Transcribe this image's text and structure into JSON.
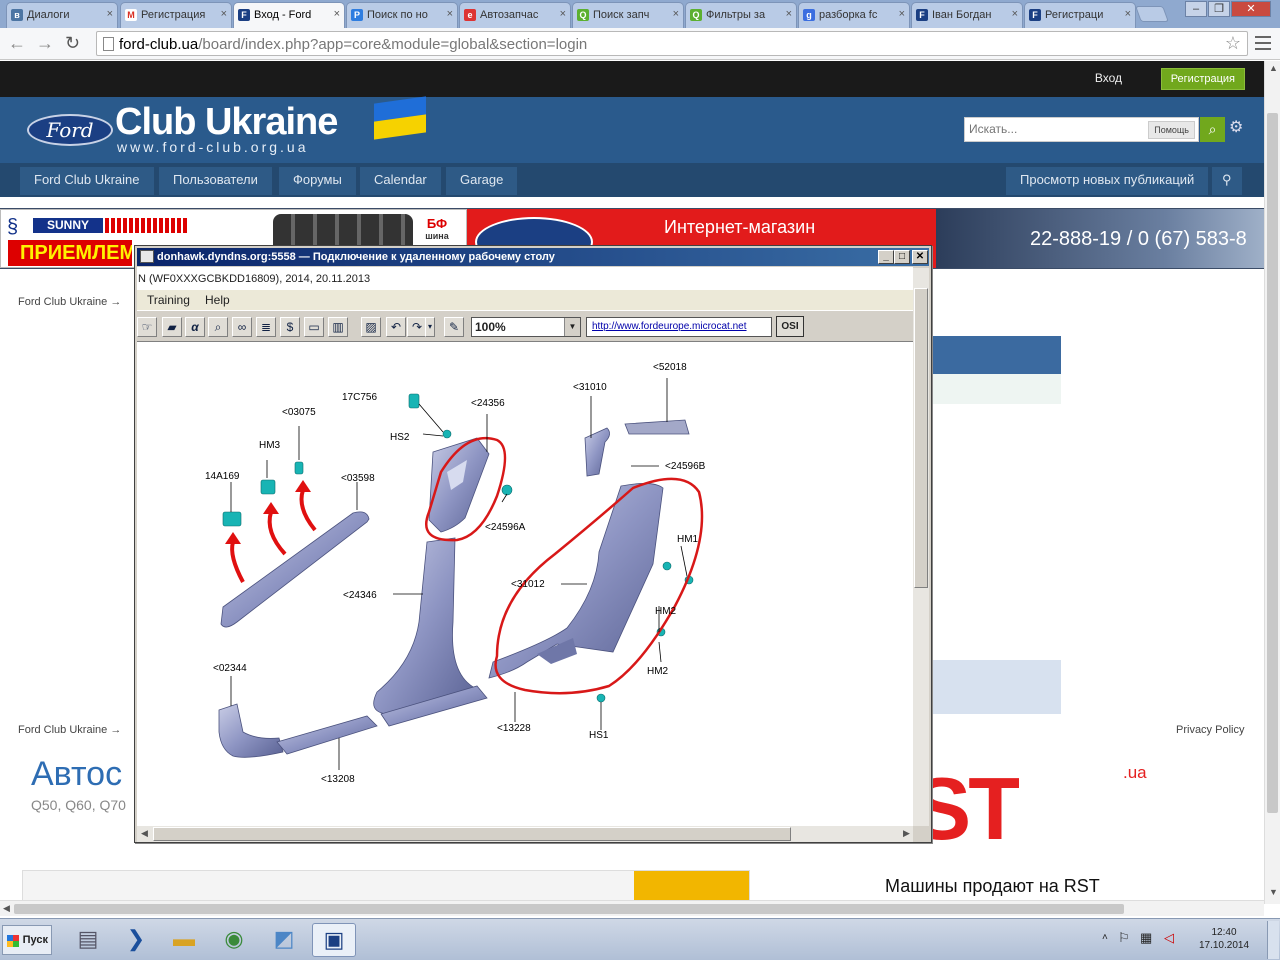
{
  "browser": {
    "tabs": [
      {
        "label": "Диалоги",
        "icon": "vk-icon",
        "color": "#4c75a3"
      },
      {
        "label": "Регистрация",
        "icon": "gmail-icon",
        "color": "#d93025"
      },
      {
        "label": "Вход - Ford",
        "icon": "ford-icon",
        "color": "#1b3f83",
        "active": true
      },
      {
        "label": "Поиск по но",
        "icon": "parts-icon",
        "color": "#2e7de0"
      },
      {
        "label": "Автозапчас",
        "icon": "exist-icon",
        "color": "#d33"
      },
      {
        "label": "Поиск запч",
        "icon": "search-parts-icon",
        "color": "#5cb030"
      },
      {
        "label": "Фильтры за",
        "icon": "filters-icon",
        "color": "#5cb030"
      },
      {
        "label": "разборка fc",
        "icon": "google-icon",
        "color": "#3b6ee0"
      },
      {
        "label": "Іван Богдан",
        "icon": "ford-icon",
        "color": "#1b3f83"
      },
      {
        "label": "Регистраци",
        "icon": "ford-icon",
        "color": "#1b3f83"
      }
    ],
    "url_host": "ford-club.ua",
    "url_path": "/board/index.php?app=core&module=global&section=login"
  },
  "site": {
    "signin": "Вход",
    "register": "Регистрация",
    "logo_title": "Club Ukraine",
    "logo_sub": "www.ford-club.org.ua",
    "ford_logo": "Ford",
    "search_placeholder": "Искать...",
    "search_help": "Помощь",
    "nav": [
      "Ford Club Ukraine",
      "Пользователи",
      "Форумы",
      "Calendar",
      "Garage"
    ],
    "nav_right": "Просмотр новых публикаций",
    "breadcrumb": "Ford Club Ukraine",
    "privacy": "Privacy Policy",
    "accent_green": "#71a81d",
    "header_blue": "#2a5a8c"
  },
  "ads": {
    "sunny": "SUNNY",
    "priem": "ПРИЕМЛЕМ",
    "bf": "БФ",
    "bf_sub": "шина",
    "shop": "Интернет-магазин",
    "phone": "22-888-19 / 0 (67) 583-8",
    "avto": "Автос",
    "q50": "Q50, Q60, Q70",
    "rst_ua": ".ua",
    "rst": "RST",
    "rst_tag": "Машины продают на RST"
  },
  "rdp": {
    "title": "donhawk.dyndns.org:5558 — Подключение к удаленному рабочему столу",
    "inner_title": "N (WF0XXXGCBKDD16809), 2014, 20.11.2013",
    "menu": [
      "Training",
      "Help"
    ],
    "zoom": "100%",
    "url": "http://www.fordeurope.microcat.net",
    "osi": "OSI"
  },
  "diagram_labels": [
    {
      "id": "17C756",
      "text": "17C756"
    },
    {
      "id": "HS2",
      "text": "HS2"
    },
    {
      "id": "24356",
      "text": "<24356"
    },
    {
      "id": "03075",
      "text": "<03075"
    },
    {
      "id": "HM3",
      "text": "HM3"
    },
    {
      "id": "14A169",
      "text": "14A169"
    },
    {
      "id": "03598",
      "text": "<03598"
    },
    {
      "id": "24596A",
      "text": "<24596A"
    },
    {
      "id": "31010",
      "text": "<31010"
    },
    {
      "id": "52018",
      "text": "<52018"
    },
    {
      "id": "24596B",
      "text": "<24596B"
    },
    {
      "id": "HM1",
      "text": "HM1"
    },
    {
      "id": "31012",
      "text": "<31012"
    },
    {
      "id": "HM2a",
      "text": "HM2"
    },
    {
      "id": "HM2b",
      "text": "HM2"
    },
    {
      "id": "24346",
      "text": "<24346"
    },
    {
      "id": "02344",
      "text": "<02344"
    },
    {
      "id": "13228",
      "text": "<13228"
    },
    {
      "id": "HS1",
      "text": "HS1"
    },
    {
      "id": "13208",
      "text": "<13208"
    }
  ],
  "taskbar": {
    "start": "Пуск",
    "time": "12:40",
    "date": "17.10.2014",
    "apps": [
      "server-manager-icon",
      "powershell-icon",
      "explorer-icon",
      "chrome-icon",
      "notes-icon",
      "remote-desktop-icon"
    ]
  }
}
